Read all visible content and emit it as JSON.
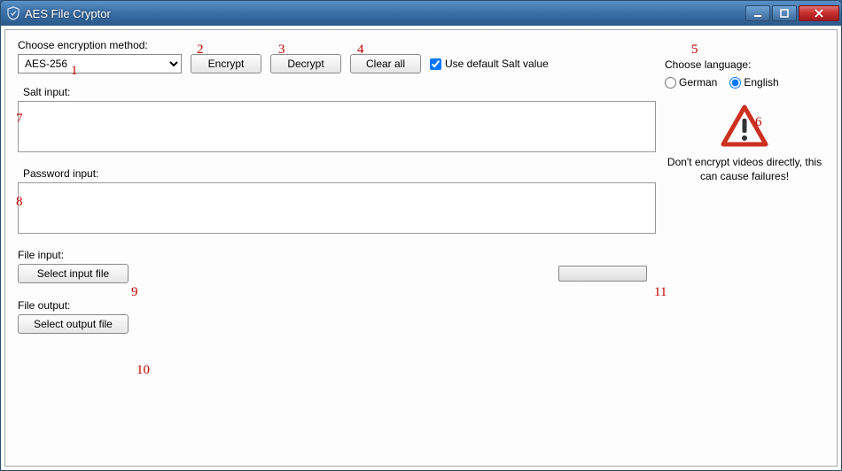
{
  "window": {
    "title": "AES File Cryptor"
  },
  "labels": {
    "method": "Choose encryption method:",
    "salt": "Salt input:",
    "password": "Password input:",
    "file_input": "File input:",
    "file_output": "File output:",
    "language": "Choose language:"
  },
  "method": {
    "selected": "AES-256",
    "options": [
      "AES-256"
    ]
  },
  "buttons": {
    "encrypt": "Encrypt",
    "decrypt": "Decrypt",
    "clear_all": "Clear all",
    "select_input": "Select input file",
    "select_output": "Select output file"
  },
  "checkbox": {
    "default_salt_label": "Use default Salt value",
    "default_salt_checked": true
  },
  "inputs": {
    "salt_value": "",
    "password_value": ""
  },
  "language": {
    "german": "German",
    "english": "English",
    "selected": "english"
  },
  "warning": {
    "text": "Don't encrypt videos directly, this can cause failures!"
  },
  "annotations": {
    "a1": "1",
    "a2": "2",
    "a3": "3",
    "a4": "4",
    "a5": "5",
    "a6": "6",
    "a7": "7",
    "a8": "8",
    "a9": "9",
    "a10": "10",
    "a11": "11"
  }
}
